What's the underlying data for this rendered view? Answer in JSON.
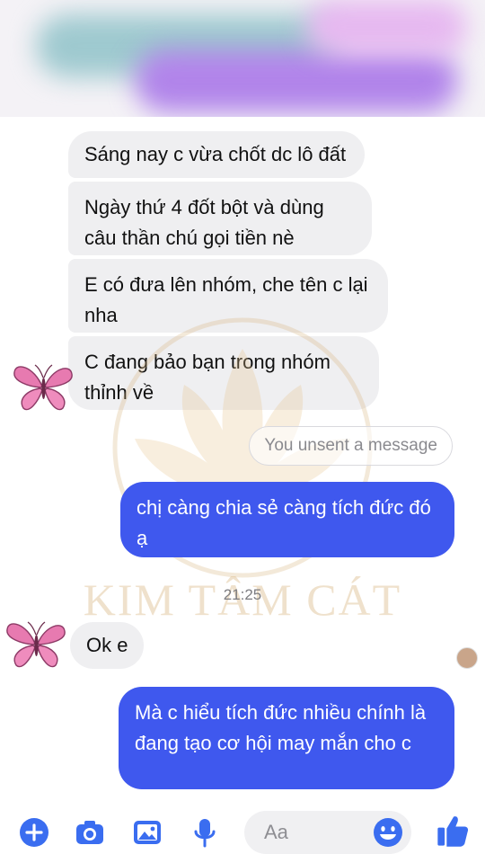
{
  "messages": [
    {
      "type": "received",
      "text": "Sáng nay c vừa chốt dc lô đất"
    },
    {
      "type": "received",
      "text": "Ngày thứ 4 đốt bột và dùng câu thần chú gọi tiền nè"
    },
    {
      "type": "received",
      "text": "E có đưa lên nhóm, che tên c lại nha"
    },
    {
      "type": "received",
      "text": "C đang bảo bạn trong nhóm thỉnh về"
    },
    {
      "type": "unsent",
      "text": "You unsent a message"
    },
    {
      "type": "sent",
      "text": "chị càng chia sẻ càng tích đức đó ạ"
    },
    {
      "type": "received",
      "text": "Ok e"
    },
    {
      "type": "sent",
      "text": "Mà c hiểu tích đức nhiều chính là đang tạo cơ hội may mắn cho c"
    }
  ],
  "timestamp": "21:25",
  "watermark": "KIM TÂM CÁT",
  "composer": {
    "placeholder": "Aa",
    "icons": [
      "plus-icon",
      "camera-icon",
      "image-icon",
      "mic-icon",
      "emoji-icon",
      "thumbs-up-icon"
    ]
  },
  "colors": {
    "sent_bubble": "#3f58ee",
    "received_bubble": "#efeff1",
    "toolbar_icon": "#3a6df0",
    "watermark": "#d7b27a"
  }
}
